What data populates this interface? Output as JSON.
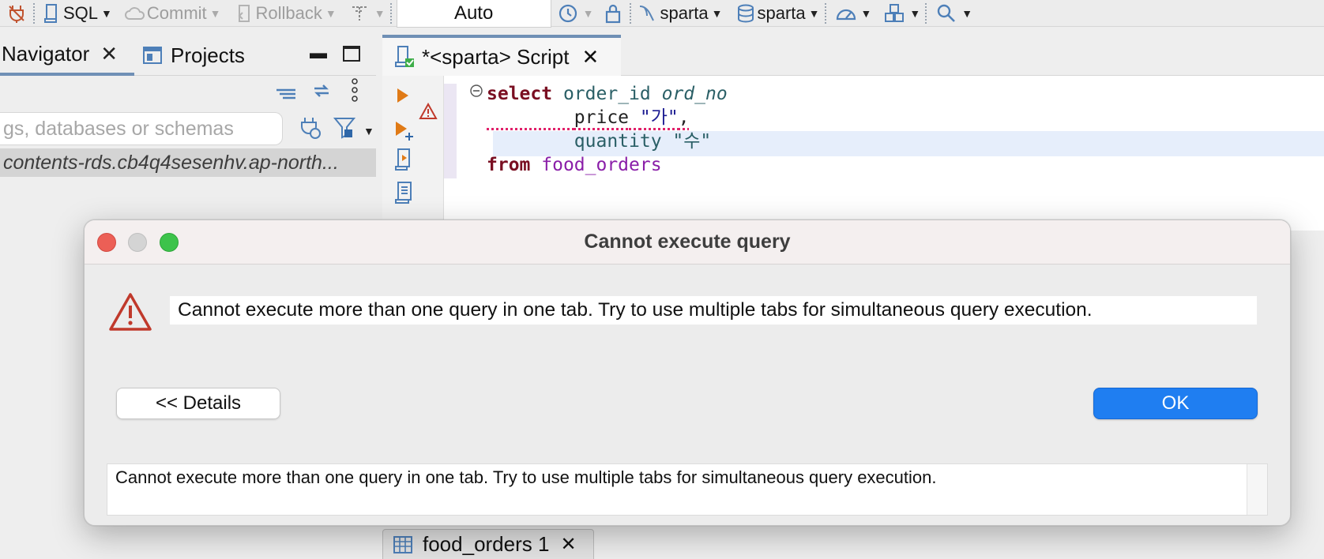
{
  "toolbar": {
    "sql_label": "SQL",
    "commit_label": "Commit",
    "rollback_label": "Rollback",
    "transaction_mode": "Auto",
    "datasource": "sparta",
    "schema": "sparta"
  },
  "navigator": {
    "tabs": [
      {
        "label": "Navigator"
      },
      {
        "label": "Projects"
      }
    ],
    "search_placeholder": "gs, databases or schemas",
    "connection_label": "contents-rds.cb4q4sesenhv.ap-north..."
  },
  "editor": {
    "tab_label": "*<sparta> Script",
    "code": {
      "line1_kw": "select",
      "line1_col": "order_id",
      "line1_alias": "ord_no",
      "line2_col": "price",
      "line2_str": "\"가\"",
      "line2_comma": ",",
      "line3_col": "quantity",
      "line3_str": "\"수\"",
      "line4_kw": "from",
      "line4_table": "food_orders"
    }
  },
  "result_tab": {
    "label": "food_orders 1"
  },
  "dialog": {
    "title": "Cannot execute query",
    "message": "Cannot execute more than one query in one tab. Try to use multiple tabs for simultaneous query execution.",
    "details_button": "<< Details",
    "ok_button": "OK",
    "details_text": "Cannot execute more than one query in one tab. Try to use multiple tabs for simultaneous query execution."
  },
  "colors": {
    "accent_blue": "#1f7ef1",
    "warning_red": "#c0392b",
    "keyword": "#7a0f22",
    "table_name": "#8a1ea8"
  }
}
